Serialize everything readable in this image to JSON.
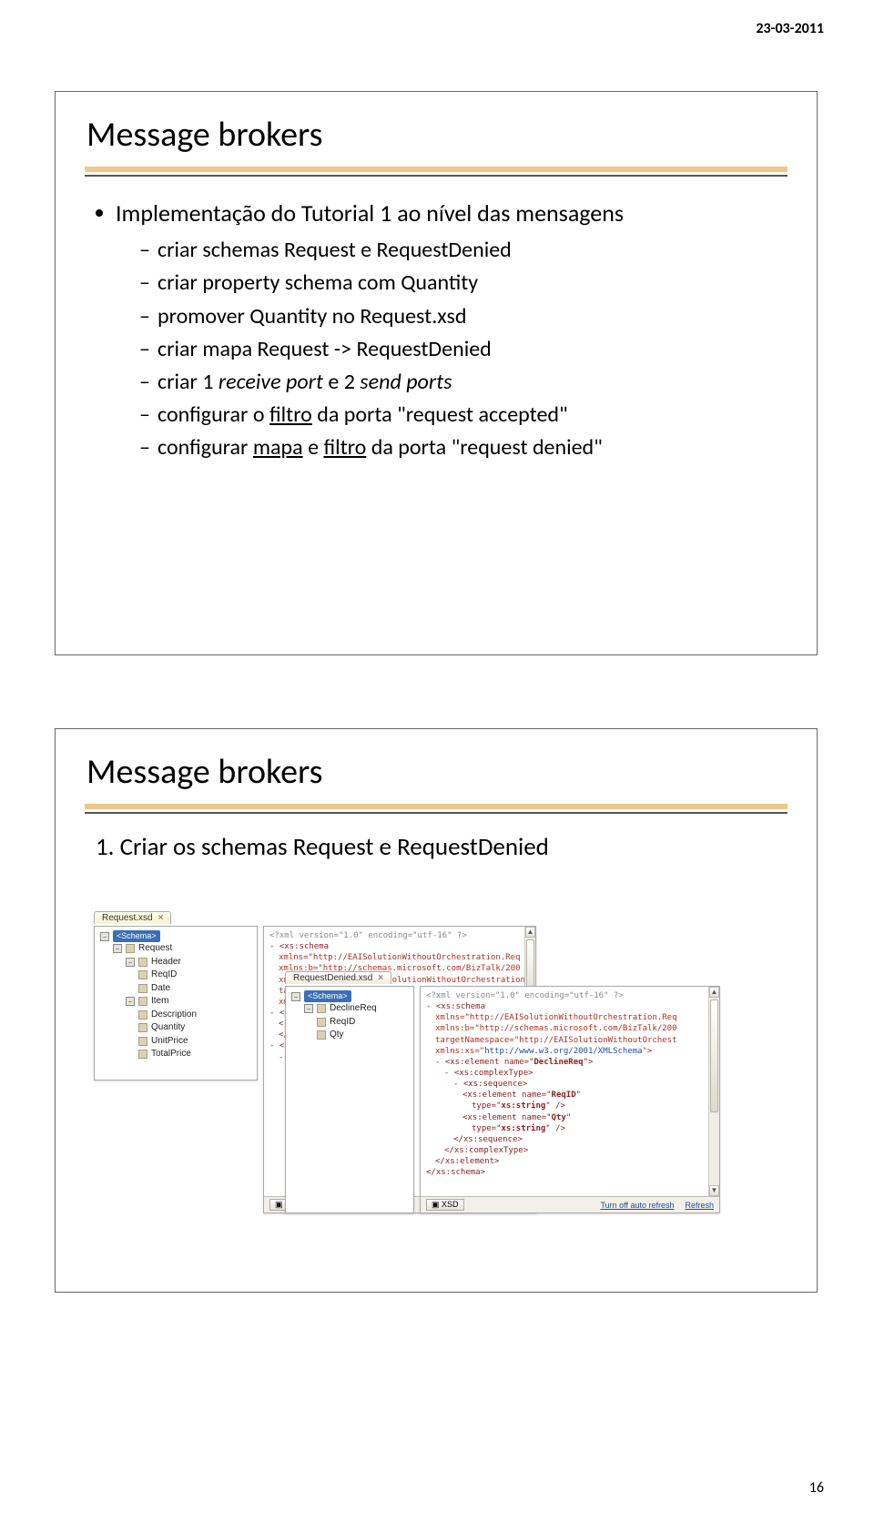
{
  "page": {
    "date": "23-03-2011",
    "number": "16"
  },
  "slide1": {
    "title": "Message brokers",
    "bullet1": "Implementação do Tutorial 1 ao nível das mensagens",
    "subs": [
      {
        "pre": "criar schemas Request e RequestDenied"
      },
      {
        "pre": "criar property schema com Quantity"
      },
      {
        "pre": "promover Quantity no Request.xsd"
      },
      {
        "pre": "criar mapa Request -> RequestDenied"
      },
      {
        "pre": "criar 1 ",
        "i1": "receive port",
        "mid": " e 2 ",
        "i2": "send ports"
      },
      {
        "pre": "configurar o ",
        "u1": "filtro",
        "post": " da porta \"request accepted\""
      },
      {
        "pre": "configurar ",
        "u1": "mapa",
        "mid": " e ",
        "u2": "filtro",
        "post": " da porta \"request denied\""
      }
    ]
  },
  "slide2": {
    "title": "Message brokers",
    "step": "1. Criar os schemas Request e RequestDenied",
    "request_tab": "Request.xsd",
    "request_tree": {
      "root": "<Schema>",
      "n1": "Request",
      "n2": "Header",
      "n3": "ReqID",
      "n4": "Date",
      "n5": "Item",
      "n6": "Description",
      "n7": "Quantity",
      "n8": "UnitPrice",
      "n9": "TotalPrice"
    },
    "denied_tab": "RequestDenied.xsd",
    "denied_tree": {
      "root": "<Schema>",
      "n1": "DeclineReq",
      "n2": "ReqID",
      "n3": "Qty"
    },
    "xml1": {
      "decl": "<?xml version=\"1.0\" encoding=\"utf-16\" ?>",
      "l1": "- <xs:schema",
      "l2": "xmlns=\"http://EAISolutionWithoutOrchestration.Req",
      "l3": "xmlns:b=\"http://schemas.microsoft.com/BizTalk/200",
      "l4": "xmlns:ns0=\"https://EAISolutionWithoutOrchestration",
      "l5": "tar",
      "l6": "xm",
      "l7": "- <x",
      "l8": "<",
      "l9": "</x",
      "l10": "- <xs",
      "l11": "- <xs",
      "l12": "- <"
    },
    "xml2": {
      "decl": "<?xml version=\"1.0\" encoding=\"utf-16\" ?>",
      "l1": "- <xs:schema",
      "l2": "xmlns=\"http://EAISolutionWithoutOrchestration.Req",
      "l3": "xmlns:b=\"http://schemas.microsoft.com/BizTalk/200",
      "l4": "targetNamespace=\"http://EAISolutionWithoutOrchest",
      "l5": "xmlns:xs=\"http://www.w3.org/2001/XMLSchema\">",
      "l6": "- <xs:element name=\"DeclineReq\">",
      "l7": "- <xs:complexType>",
      "l8": "- <xs:sequence>",
      "l9a": "<xs:element name=\"ReqID\"",
      "l9b": "type=\"xs:string\" />",
      "l10a": "<xs:element name=\"Qty\"",
      "l10b": "type=\"xs:string\" />",
      "l11": "</xs:sequence>",
      "l12": "</xs:complexType>",
      "l13": "</xs:element>",
      "l14": "</xs:schema>"
    },
    "footer": {
      "xsd": "XSD",
      "turnoff": "Turn off auto refresh",
      "turnoff_short": "Turn off a",
      "refresh": "Refresh"
    }
  }
}
